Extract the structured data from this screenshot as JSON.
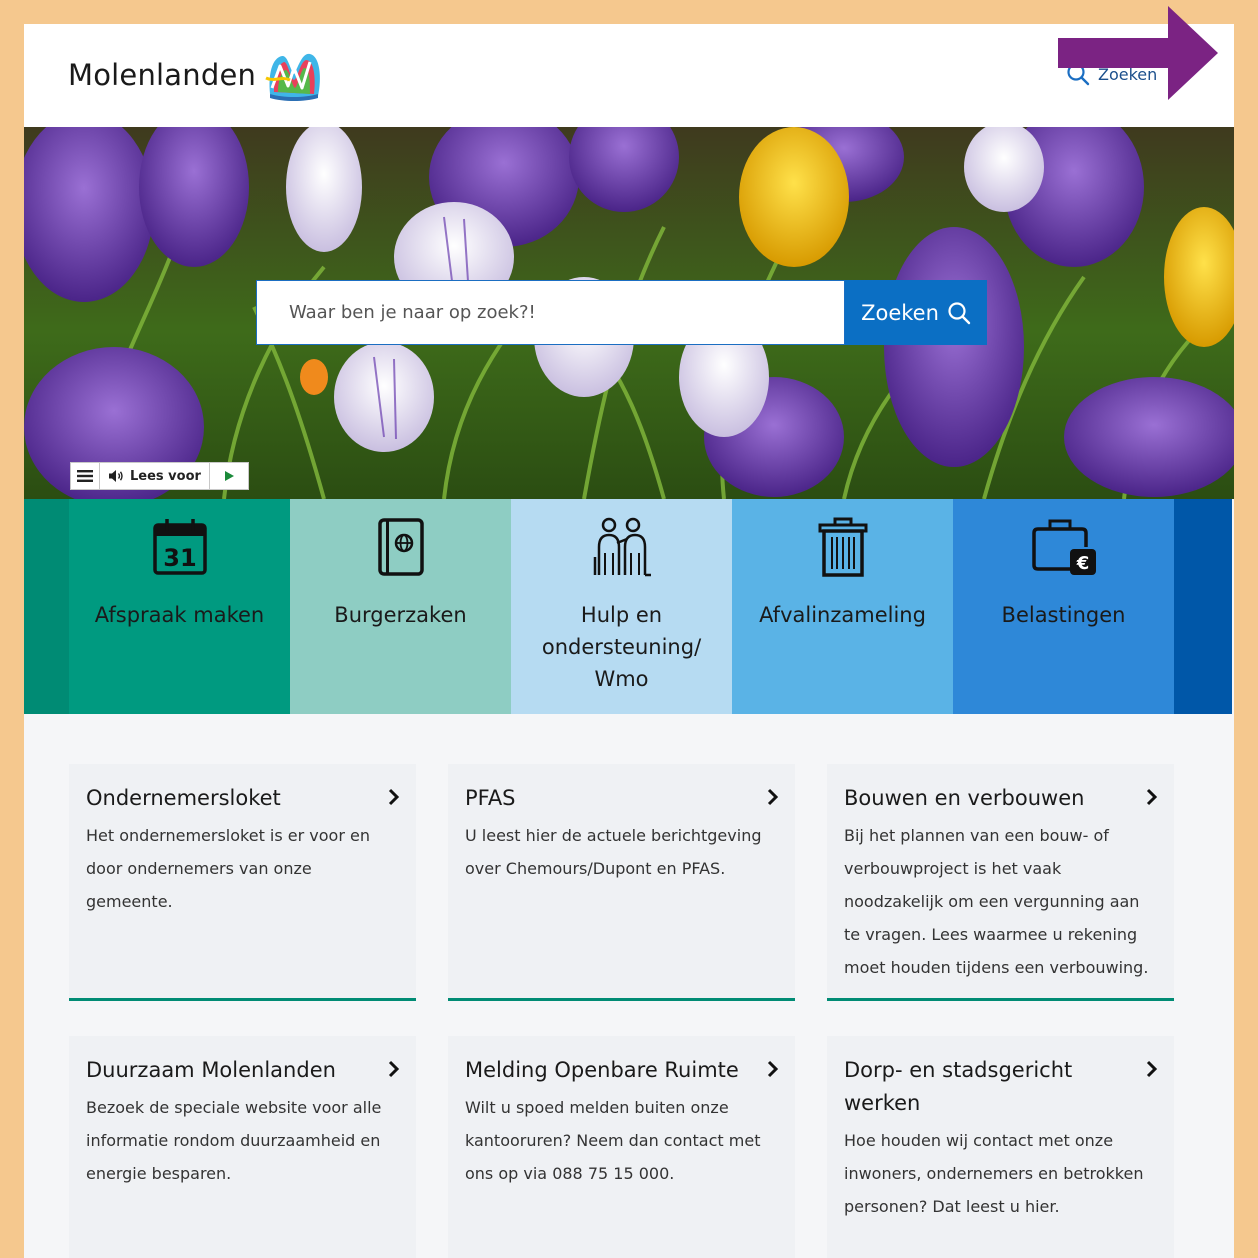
{
  "header": {
    "logo_text": "Molenlanden",
    "search_label": "Zoeken"
  },
  "hero": {
    "search_placeholder": "Waar ben je naar op zoek?!",
    "search_button_label": "Zoeken",
    "readspeaker_label": "Lees voor"
  },
  "tiles": [
    {
      "label": "Afspraak maken",
      "icon": "calendar-icon",
      "color": "#009a80"
    },
    {
      "label": "Burgerzaken",
      "icon": "passport-icon",
      "color": "#8ecdc3"
    },
    {
      "label": "Hulp en ondersteuning/ Wmo",
      "icon": "care-people-icon",
      "color": "#b6dbf2"
    },
    {
      "label": "Afvalinzameling",
      "icon": "trash-bin-icon",
      "color": "#5ab3e6"
    },
    {
      "label": "Belastingen",
      "icon": "wallet-euro-icon",
      "color": "#2e88d8"
    }
  ],
  "calendar_day": "31",
  "cards": [
    {
      "title": "Ondernemersloket",
      "text": "Het ondernemersloket is er voor en door ondernemers van onze gemeente."
    },
    {
      "title": "PFAS",
      "text": "U leest hier de actuele berichtgeving over Chemours/Dupont en PFAS."
    },
    {
      "title": "Bouwen en verbouwen",
      "text": "Bij het plannen van een bouw- of verbouwproject is het vaak noodzakelijk om een vergunning aan te vragen. Lees waarmee u rekening moet houden tijdens een verbouwing."
    },
    {
      "title": "Duurzaam Molenlanden",
      "text": "Bezoek de speciale website voor alle informatie rondom duurzaamheid en energie besparen."
    },
    {
      "title": "Melding Openbare Ruimte",
      "text": "Wilt u spoed melden buiten onze kantooruren? Neem dan contact met ons op via 088 75 15 000."
    },
    {
      "title": "Dorp- en stadsgericht werken",
      "text": "Hoe houden wij contact met onze inwoners, ondernemers en betrokken personen? Dat leest u hier."
    }
  ],
  "colors": {
    "page_border": "#f5c88e",
    "primary_blue": "#0b6fc4",
    "accent_green": "#008b74",
    "annotation_arrow": "#7b2383"
  }
}
